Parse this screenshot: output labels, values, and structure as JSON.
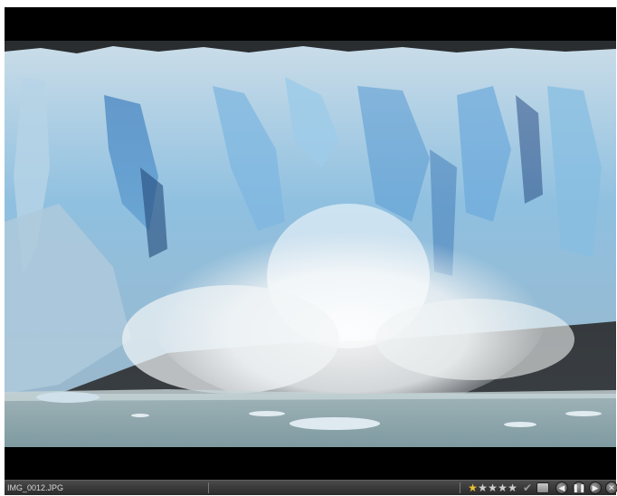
{
  "status": {
    "filename": "IMG_0012.JPG",
    "rating": 1,
    "max_rating": 5
  },
  "icons": {
    "approve": "checkmark-icon",
    "print": "print-icon",
    "prev": "previous-icon",
    "pause": "pause-icon",
    "next": "next-icon",
    "close": "close-icon"
  },
  "colors": {
    "star_active": "#e8c230",
    "star_inactive": "#cfcfcf",
    "background": "#000000"
  }
}
